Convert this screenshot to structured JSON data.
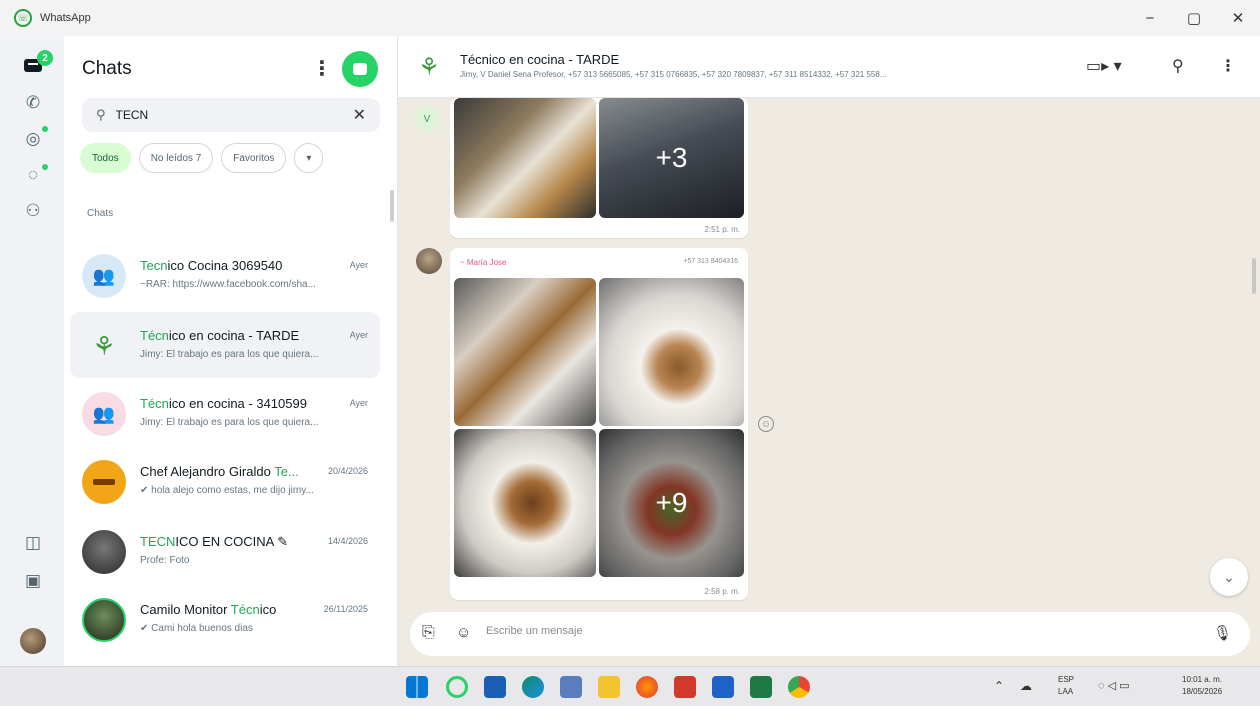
{
  "window": {
    "app_title": "WhatsApp",
    "minimize": "−",
    "maximize": "▢",
    "close": "✕"
  },
  "rail": {
    "chats_badge": "2"
  },
  "panel": {
    "title": "Chats",
    "search_value": "TECN",
    "filters": [
      "Todos",
      "No leídos 7",
      "Favoritos",
      "▾"
    ],
    "section_label": "Chats",
    "chats": [
      {
        "name_highlight": "Tecn",
        "name_rest": "ico Cocina 3069540",
        "time": "Ayer",
        "preview": "~RAR: https://www.facebook.com/sha..."
      },
      {
        "name_highlight": "Técn",
        "name_rest": "ico en cocina - TARDE",
        "time": "Ayer",
        "preview": "Jimy: El trabajo es para los que quiera..."
      },
      {
        "name_highlight": "Técn",
        "name_rest": "ico en cocina - 3410599",
        "time": "Ayer",
        "preview": "Jimy: El trabajo es para los que quiera..."
      },
      {
        "name_prefix": "Chef Alejandro Giraldo ",
        "name_highlight": "Te...",
        "name_rest": "",
        "time": "20/4/2026",
        "preview": "✔ hola alejo como estas, me dijo jimy..."
      },
      {
        "name_highlight": "TECN",
        "name_rest": "ICO EN COCINA ✎",
        "time": "14/4/2026",
        "preview": "Profe: Foto"
      },
      {
        "name_prefix": "Camilo Monitor ",
        "name_highlight": "Técn",
        "name_rest": "ico",
        "time": "26/11/2025",
        "preview": "✔ Cami hola buenos dias"
      }
    ]
  },
  "conversation": {
    "group_title": "Técnico en cocina - TARDE",
    "group_members": "Jimy, V Daniel Sena Profesor, +57 313 5665085, +57 315 0766835, +57 320 7809837, +57 311 8514332, +57 321 558...",
    "msg1": {
      "avatar_letter": "V",
      "more_count": "+3",
      "time": "2:51 p. m."
    },
    "msg2": {
      "sender": "~ María Jose",
      "phone": "+57 313 8404316",
      "more_count": "+9",
      "time": "2:58 p. m."
    },
    "composer_placeholder": "Escribe un mensaje"
  },
  "taskbar": {
    "lang_top": "ESP",
    "lang_bottom": "LAA",
    "time": "10:01 a. m.",
    "date": "18/05/2026"
  },
  "colors": {
    "accent": "#25d366",
    "highlight_text": "#1fa855",
    "chat_bg": "#efeae2"
  }
}
